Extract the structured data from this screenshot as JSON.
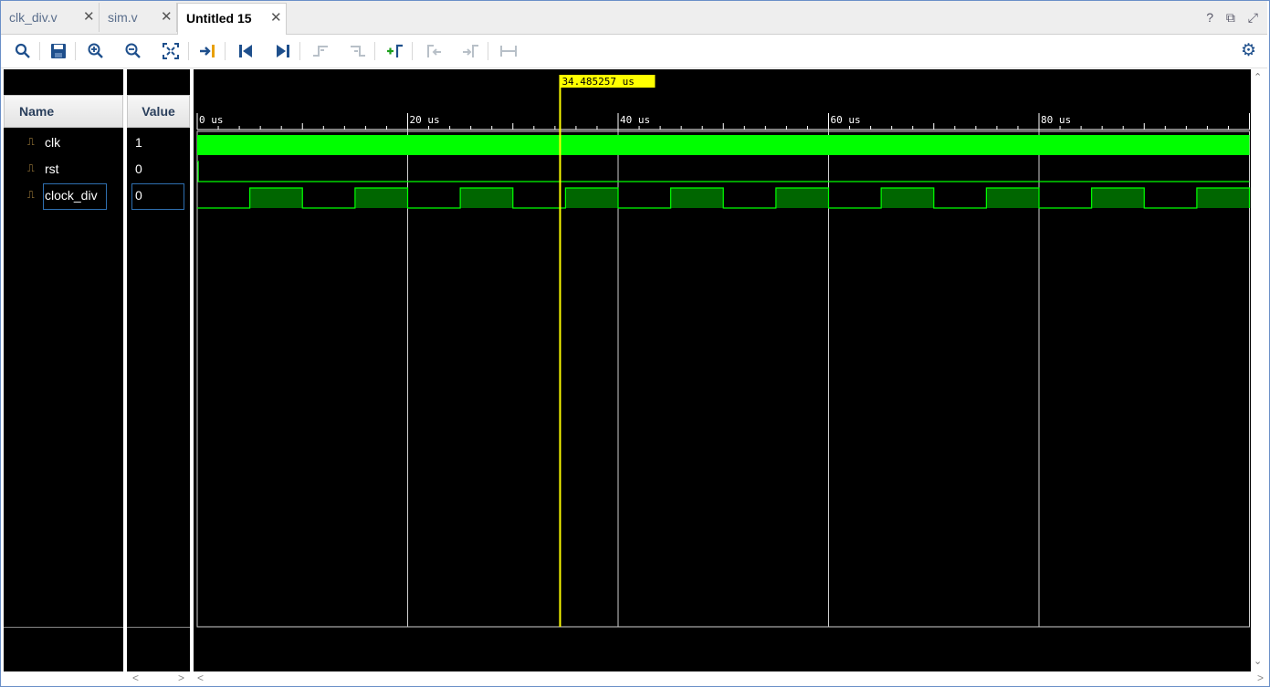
{
  "tabs": [
    {
      "label": "clk_div.v",
      "active": false
    },
    {
      "label": "sim.v",
      "active": false
    },
    {
      "label": "Untitled 15",
      "active": true
    }
  ],
  "window_icons": [
    "?",
    "⧉",
    "⤢"
  ],
  "toolbar": {
    "buttons": [
      {
        "name": "search-icon",
        "glyph": "🔍",
        "enabled": true
      },
      {
        "name": "save-icon",
        "glyph": "💾",
        "enabled": true
      },
      {
        "name": "zoom-in-icon",
        "glyph": "⊕",
        "enabled": true
      },
      {
        "name": "zoom-out-icon",
        "glyph": "⊖",
        "enabled": true
      },
      {
        "name": "zoom-fit-icon",
        "glyph": "⛶",
        "enabled": true
      },
      {
        "name": "go-to-cursor-icon",
        "glyph": "⇥",
        "enabled": true
      },
      {
        "name": "go-to-time-zero-icon",
        "glyph": "⏮",
        "enabled": true
      },
      {
        "name": "go-to-last-time-icon",
        "glyph": "⏭",
        "enabled": true
      },
      {
        "name": "previous-transition-icon",
        "glyph": "⇤",
        "enabled": false
      },
      {
        "name": "next-transition-icon",
        "glyph": "⇥",
        "enabled": false
      },
      {
        "name": "add-marker-icon",
        "glyph": "+⎾",
        "enabled": true
      },
      {
        "name": "previous-marker-icon",
        "glyph": "⎾",
        "enabled": false
      },
      {
        "name": "next-marker-icon",
        "glyph": "⎿",
        "enabled": false
      },
      {
        "name": "swap-cursors-icon",
        "glyph": "⊢⊣",
        "enabled": false
      }
    ],
    "settings_icon": "gear-icon"
  },
  "columns": {
    "name": "Name",
    "value": "Value"
  },
  "signals": [
    {
      "name": "clk",
      "value": "1",
      "selected": false
    },
    {
      "name": "rst",
      "value": "0",
      "selected": false
    },
    {
      "name": "clock_div",
      "value": "0",
      "selected": true
    }
  ],
  "timeline": {
    "unit": "us",
    "tick_labels": [
      "0 us",
      "20 us",
      "40 us",
      "60 us",
      "80 us"
    ],
    "major_ticks_us": [
      0,
      20,
      40,
      60,
      80
    ],
    "range_us": [
      0,
      100
    ],
    "cursor": {
      "time_us": 34.485257,
      "label": "34.485257 us",
      "color": "#ffff00"
    }
  },
  "waveforms": {
    "clk": {
      "kind": "fast-clock",
      "color": "#00ff00"
    },
    "rst": {
      "initial": 1,
      "falls_at_us": 0.1,
      "color": "#00ff00"
    },
    "clock_div": {
      "period_us": 10,
      "high_from_offset_us": 5,
      "high_to_offset_us": 10,
      "color": "#00ff00",
      "fill": "#006600"
    }
  },
  "colors": {
    "wave_bg": "#000000",
    "wave_line": "#00ff00",
    "grid": "#d0d0d0",
    "cursor": "#ffff00"
  }
}
